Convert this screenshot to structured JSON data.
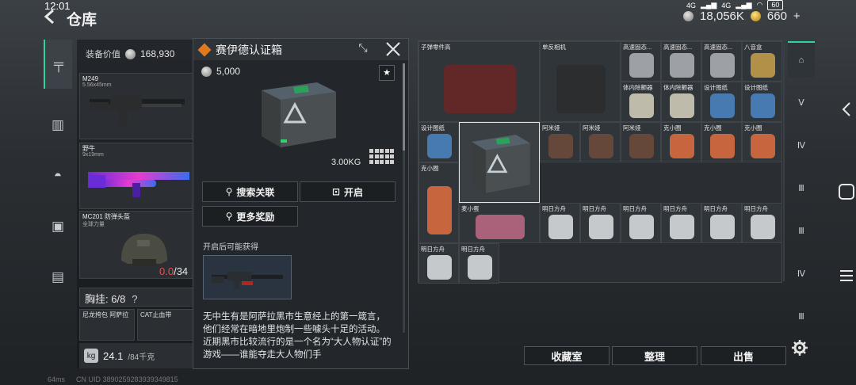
{
  "status_bar": {
    "time": "12:01",
    "signal_label": "4G",
    "signal_label2": "4G",
    "battery": "60"
  },
  "header": {
    "title": "仓库",
    "silver_amount": "18,056K",
    "gold_amount": "660",
    "gold_plus": "+"
  },
  "equipment": {
    "value_label": "装备价值",
    "value": "168,930",
    "weapon1_name": "M249",
    "weapon1_caliber": "5.56x45mm",
    "weapon2_name": "野牛",
    "weapon2_caliber": "9x19mm",
    "helmet_name": "MC201 防弹头盔",
    "helmet_sub": "全球力量",
    "helmet_dur_cur": "0.0",
    "helmet_dur_sep": "/34",
    "chest_label": "胸挂: 6/8",
    "chest_q": "?",
    "chest_slot1": "尼龙挎包 阿萨拉",
    "chest_slot2": "CAT止血带",
    "weight_value": "24.1",
    "weight_max": "/84千克"
  },
  "popup": {
    "title": "赛伊德认证箱",
    "price": "5,000",
    "weight": "3.00KG",
    "btn_search": "搜索关联",
    "btn_open": "开启",
    "btn_more": "更多奖励",
    "possible_label": "开启后可能获得",
    "description": "无中生有是阿萨拉黑市生意经上的第一箴言，他们经常在暗地里炮制一些噱头十足的活动。近期黑市比较流行的是一个名为“大人物认证”的游戏——谁能夺走大人物们手"
  },
  "warehouse": {
    "items": [
      {
        "label": "子弹零件高"
      },
      {
        "label": "单反相机"
      },
      {
        "label": "高速固态..."
      },
      {
        "label": "高速固态..."
      },
      {
        "label": "高速固态..."
      },
      {
        "label": "八音盒"
      },
      {
        "label": "体内除颤器"
      },
      {
        "label": "体内除颤器"
      },
      {
        "label": "设计图纸"
      },
      {
        "label": "设计图纸"
      },
      {
        "label": "设计图纸"
      },
      {
        "label": "阿米娅"
      },
      {
        "label": "阿米娅"
      },
      {
        "label": "阿米娅"
      },
      {
        "label": "克小圈"
      },
      {
        "label": "克小圈"
      },
      {
        "label": "克小圈"
      },
      {
        "label": "克小圈"
      },
      {
        "label": "麦小蛋"
      },
      {
        "label": "明日方舟"
      },
      {
        "label": "明日方舟"
      },
      {
        "label": "明日方舟"
      },
      {
        "label": "明日方舟"
      },
      {
        "label": "明日方舟"
      },
      {
        "label": "明日方舟"
      },
      {
        "label": "明日方舟"
      },
      {
        "label": "明日方舟"
      }
    ]
  },
  "bottom": {
    "collection": "收藏室",
    "sort": "整理",
    "sell": "出售"
  },
  "footer": {
    "ping": "64ms",
    "uid": "CN UID 3890259283939349815"
  }
}
